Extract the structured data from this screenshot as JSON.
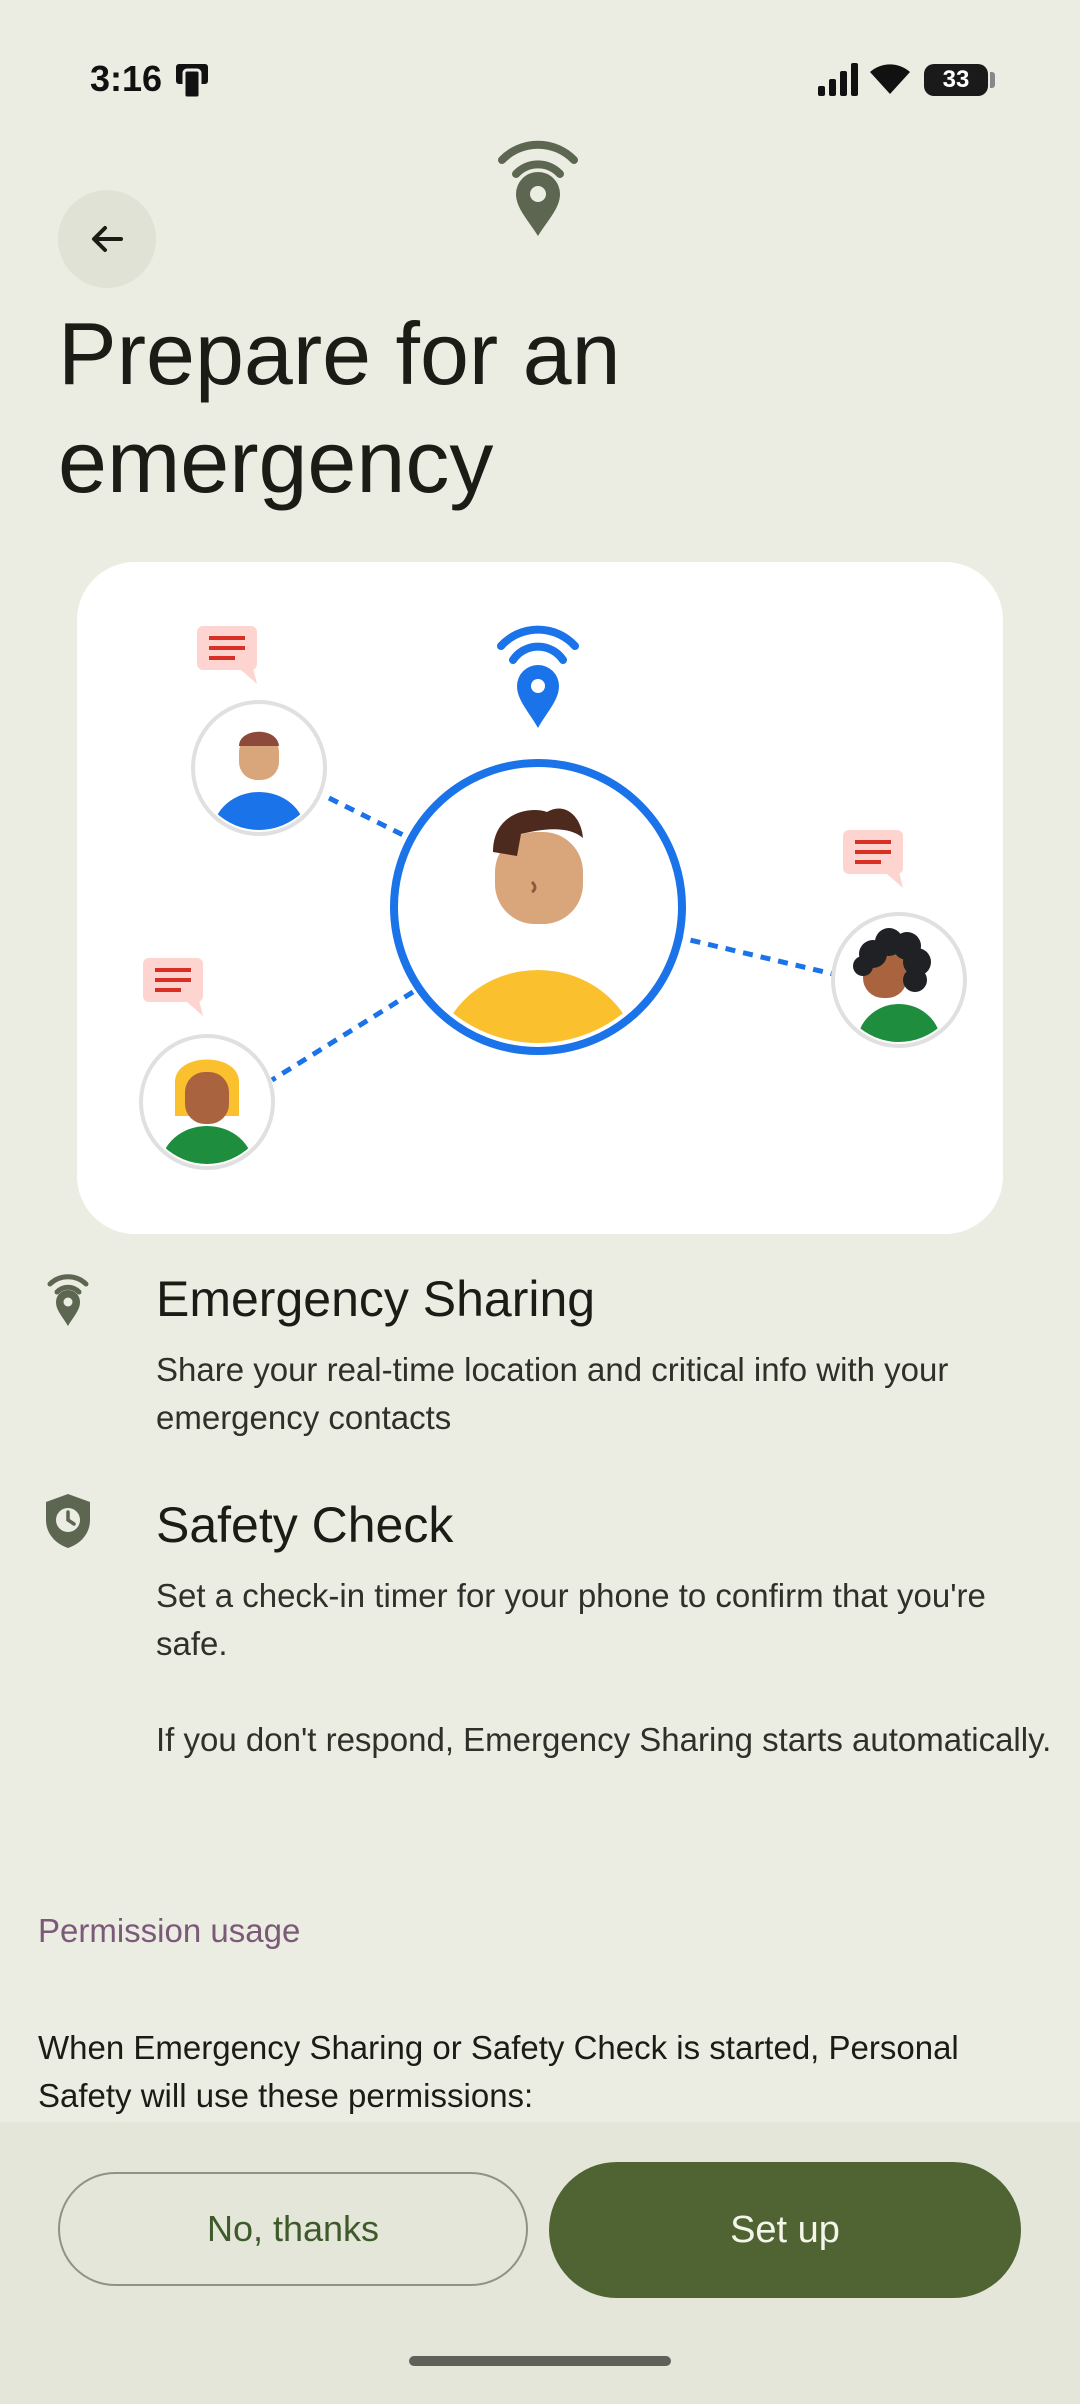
{
  "status_bar": {
    "time": "3:16",
    "battery": "33"
  },
  "header": {
    "title": "Prepare for an emergency"
  },
  "features": [
    {
      "title": "Emergency Sharing",
      "description": "Share your real-time location and critical info with your emergency contacts",
      "icon": "location-broadcast-icon"
    },
    {
      "title": "Safety Check",
      "description": "Set a check-in timer for your phone to confirm that you're safe.",
      "description_2": "If you don't respond, Emergency Sharing starts automatically.",
      "icon": "shield-clock-icon"
    }
  ],
  "permissions": {
    "heading": "Permission usage",
    "text": "When Emergency Sharing or Safety Check is started, Personal Safety will use these permissions:"
  },
  "actions": {
    "secondary": "No, thanks",
    "primary": "Set up"
  },
  "colors": {
    "accent": "#4f6432",
    "background": "#ecede2",
    "illustration_blue": "#1a73e8",
    "permission_heading": "#7a5a78"
  }
}
